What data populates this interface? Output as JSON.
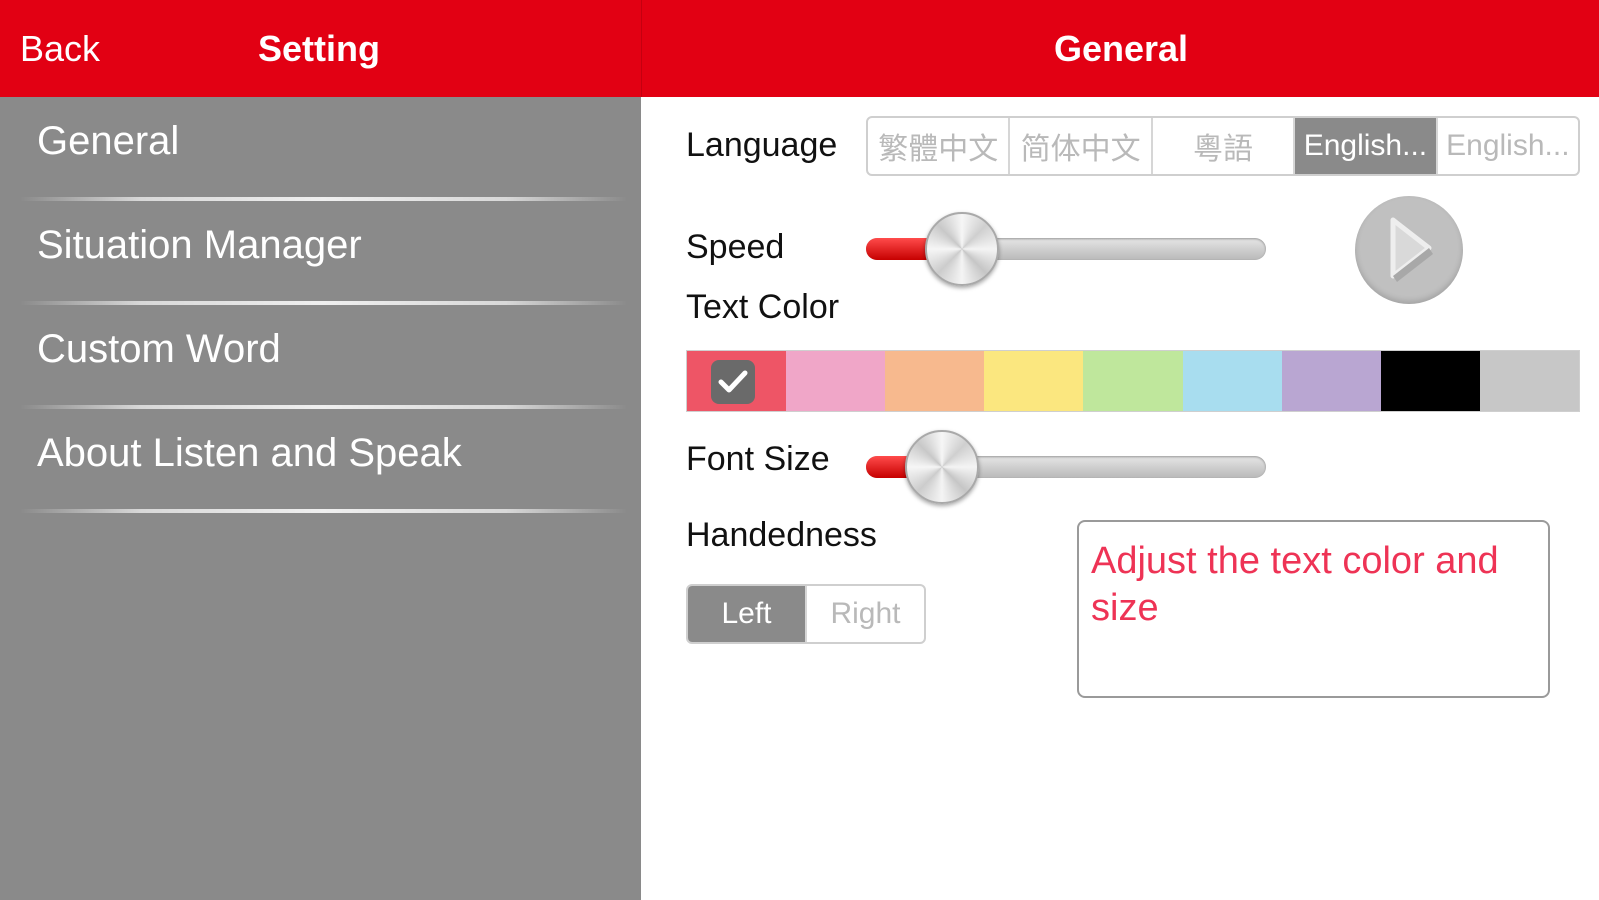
{
  "left": {
    "back_label": "Back",
    "title": "Setting",
    "menu": [
      {
        "label": "General"
      },
      {
        "label": "Situation Manager"
      },
      {
        "label": "Custom Word"
      },
      {
        "label": "About Listen and Speak"
      }
    ]
  },
  "right": {
    "title": "General",
    "language": {
      "label": "Language",
      "options": [
        "繁體中文",
        "简体中文",
        "粵語",
        "English...",
        "English..."
      ],
      "selected_index": 3
    },
    "speed": {
      "label": "Speed",
      "value_fraction": 0.24
    },
    "play_icon": "play-icon",
    "text_color": {
      "label": "Text Color",
      "swatches": [
        "#ee5566",
        "#f0a6c8",
        "#f7b98e",
        "#fbe77f",
        "#bfe79c",
        "#a8ddef",
        "#b9a6d2",
        "#000000",
        "#c7c7c7"
      ],
      "selected_index": 0
    },
    "font_size": {
      "label": "Font Size",
      "value_fraction": 0.19
    },
    "handedness": {
      "label": "Handedness",
      "options": [
        "Left",
        "Right"
      ],
      "selected_index": 0
    },
    "tip_text": "Adjust the text color and size"
  },
  "colors": {
    "header_red": "#e20013",
    "sidebar_gray": "#8a8a8a",
    "tip_text": "#ee3355"
  }
}
